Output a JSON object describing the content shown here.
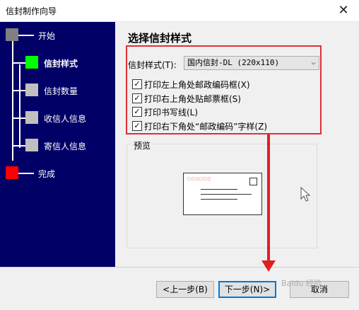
{
  "window": {
    "title": "信封制作向导",
    "close_glyph": "✕"
  },
  "sidebar": {
    "steps": [
      {
        "label": "开始",
        "box_color": "#808080",
        "current": false
      },
      {
        "label": "信封样式",
        "box_color": "#00ff00",
        "current": true
      },
      {
        "label": "信封数量",
        "box_color": "#c0c0c0",
        "current": false
      },
      {
        "label": "收信人信息",
        "box_color": "#c0c0c0",
        "current": false
      },
      {
        "label": "寄信人信息",
        "box_color": "#c0c0c0",
        "current": false
      },
      {
        "label": "完成",
        "box_color": "#ff0000",
        "current": false
      }
    ]
  },
  "main": {
    "heading": "选择信封样式",
    "style_label": "信封样式(T):",
    "style_value": "国内信封-DL (220x110)",
    "options": [
      {
        "label": "打印左上角处邮政编码框(X)",
        "checked": true
      },
      {
        "label": "打印右上角处贴邮票框(S)",
        "checked": true
      },
      {
        "label": "打印书写线(L)",
        "checked": true
      },
      {
        "label": "打印右下角处“邮政编码”字样(Z)",
        "checked": true
      }
    ],
    "preview_label": "预览",
    "postal_marks": "□□□□□□"
  },
  "footer": {
    "prev_label": "<上一步(B)",
    "next_label": "下一步(N)>",
    "cancel_label": "取消"
  },
  "watermark": "Baidu 经验",
  "colors": {
    "sidebar_bg": "#000066",
    "highlight_red": "#e03030",
    "focus_blue": "#0078d7"
  }
}
